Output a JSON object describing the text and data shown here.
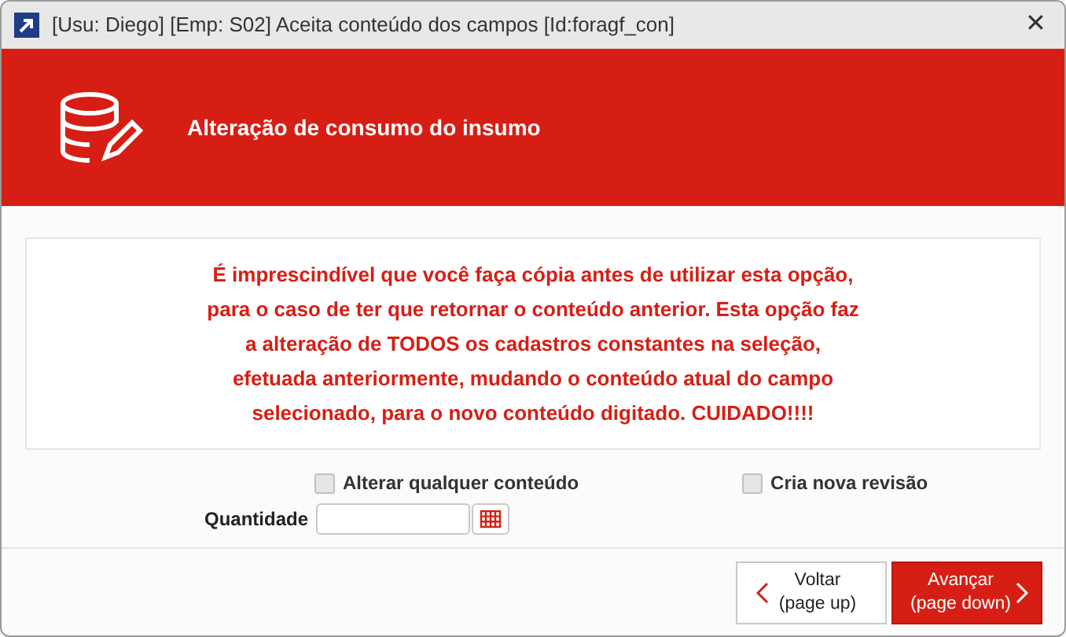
{
  "window": {
    "title": "[Usu: Diego] [Emp: S02] Aceita conteúdo dos campos [Id:foragf_con]",
    "close": "✕"
  },
  "banner": {
    "title": "Alteração de consumo do insumo"
  },
  "warning": "É imprescindível que você faça cópia antes de utilizar esta opção, para o caso de ter que retornar o conteúdo anterior. Esta opção faz a alteração de TODOS os cadastros constantes na seleção, efetuada anteriormente, mudando o conteúdo atual do campo selecionado, para o novo conteúdo digitado. CUIDADO!!!!",
  "checkboxes": [
    {
      "label": "Alterar qualquer conteúdo",
      "checked": false
    },
    {
      "label": "Cria nova revisão",
      "checked": false
    }
  ],
  "quantity": {
    "label": "Quantidade"
  },
  "buttons": [
    {
      "kind": "back",
      "label": "Voltar",
      "hint": "(page up)"
    },
    {
      "kind": "next",
      "label": "Avançar",
      "hint": "(page down)"
    }
  ]
}
